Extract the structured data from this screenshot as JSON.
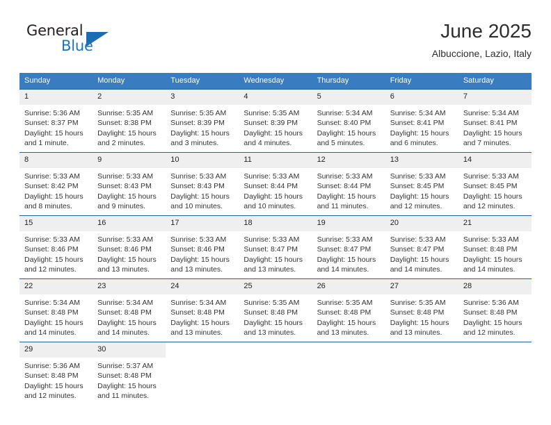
{
  "brand": {
    "name_top": "General",
    "name_bottom": "Blue",
    "flag_icon": "triangle-flag-icon",
    "color_blue": "#1b75bb",
    "color_dark": "#231f20"
  },
  "header": {
    "title": "June 2025",
    "location": "Albuccione, Lazio, Italy"
  },
  "theme": {
    "header_bg": "#3a7cc0",
    "daynum_bg": "#efefef",
    "row_divider": "#1f5fa0",
    "text": "#333333"
  },
  "weekday_headers": [
    "Sunday",
    "Monday",
    "Tuesday",
    "Wednesday",
    "Thursday",
    "Friday",
    "Saturday"
  ],
  "weeks": [
    {
      "days": [
        {
          "num": "1",
          "sunrise": "Sunrise: 5:36 AM",
          "sunset": "Sunset: 8:37 PM",
          "daylight_1": "Daylight: 15 hours",
          "daylight_2": "and 1 minute."
        },
        {
          "num": "2",
          "sunrise": "Sunrise: 5:35 AM",
          "sunset": "Sunset: 8:38 PM",
          "daylight_1": "Daylight: 15 hours",
          "daylight_2": "and 2 minutes."
        },
        {
          "num": "3",
          "sunrise": "Sunrise: 5:35 AM",
          "sunset": "Sunset: 8:39 PM",
          "daylight_1": "Daylight: 15 hours",
          "daylight_2": "and 3 minutes."
        },
        {
          "num": "4",
          "sunrise": "Sunrise: 5:35 AM",
          "sunset": "Sunset: 8:39 PM",
          "daylight_1": "Daylight: 15 hours",
          "daylight_2": "and 4 minutes."
        },
        {
          "num": "5",
          "sunrise": "Sunrise: 5:34 AM",
          "sunset": "Sunset: 8:40 PM",
          "daylight_1": "Daylight: 15 hours",
          "daylight_2": "and 5 minutes."
        },
        {
          "num": "6",
          "sunrise": "Sunrise: 5:34 AM",
          "sunset": "Sunset: 8:41 PM",
          "daylight_1": "Daylight: 15 hours",
          "daylight_2": "and 6 minutes."
        },
        {
          "num": "7",
          "sunrise": "Sunrise: 5:34 AM",
          "sunset": "Sunset: 8:41 PM",
          "daylight_1": "Daylight: 15 hours",
          "daylight_2": "and 7 minutes."
        }
      ]
    },
    {
      "days": [
        {
          "num": "8",
          "sunrise": "Sunrise: 5:33 AM",
          "sunset": "Sunset: 8:42 PM",
          "daylight_1": "Daylight: 15 hours",
          "daylight_2": "and 8 minutes."
        },
        {
          "num": "9",
          "sunrise": "Sunrise: 5:33 AM",
          "sunset": "Sunset: 8:43 PM",
          "daylight_1": "Daylight: 15 hours",
          "daylight_2": "and 9 minutes."
        },
        {
          "num": "10",
          "sunrise": "Sunrise: 5:33 AM",
          "sunset": "Sunset: 8:43 PM",
          "daylight_1": "Daylight: 15 hours",
          "daylight_2": "and 10 minutes."
        },
        {
          "num": "11",
          "sunrise": "Sunrise: 5:33 AM",
          "sunset": "Sunset: 8:44 PM",
          "daylight_1": "Daylight: 15 hours",
          "daylight_2": "and 10 minutes."
        },
        {
          "num": "12",
          "sunrise": "Sunrise: 5:33 AM",
          "sunset": "Sunset: 8:44 PM",
          "daylight_1": "Daylight: 15 hours",
          "daylight_2": "and 11 minutes."
        },
        {
          "num": "13",
          "sunrise": "Sunrise: 5:33 AM",
          "sunset": "Sunset: 8:45 PM",
          "daylight_1": "Daylight: 15 hours",
          "daylight_2": "and 12 minutes."
        },
        {
          "num": "14",
          "sunrise": "Sunrise: 5:33 AM",
          "sunset": "Sunset: 8:45 PM",
          "daylight_1": "Daylight: 15 hours",
          "daylight_2": "and 12 minutes."
        }
      ]
    },
    {
      "days": [
        {
          "num": "15",
          "sunrise": "Sunrise: 5:33 AM",
          "sunset": "Sunset: 8:46 PM",
          "daylight_1": "Daylight: 15 hours",
          "daylight_2": "and 12 minutes."
        },
        {
          "num": "16",
          "sunrise": "Sunrise: 5:33 AM",
          "sunset": "Sunset: 8:46 PM",
          "daylight_1": "Daylight: 15 hours",
          "daylight_2": "and 13 minutes."
        },
        {
          "num": "17",
          "sunrise": "Sunrise: 5:33 AM",
          "sunset": "Sunset: 8:46 PM",
          "daylight_1": "Daylight: 15 hours",
          "daylight_2": "and 13 minutes."
        },
        {
          "num": "18",
          "sunrise": "Sunrise: 5:33 AM",
          "sunset": "Sunset: 8:47 PM",
          "daylight_1": "Daylight: 15 hours",
          "daylight_2": "and 13 minutes."
        },
        {
          "num": "19",
          "sunrise": "Sunrise: 5:33 AM",
          "sunset": "Sunset: 8:47 PM",
          "daylight_1": "Daylight: 15 hours",
          "daylight_2": "and 14 minutes."
        },
        {
          "num": "20",
          "sunrise": "Sunrise: 5:33 AM",
          "sunset": "Sunset: 8:47 PM",
          "daylight_1": "Daylight: 15 hours",
          "daylight_2": "and 14 minutes."
        },
        {
          "num": "21",
          "sunrise": "Sunrise: 5:33 AM",
          "sunset": "Sunset: 8:48 PM",
          "daylight_1": "Daylight: 15 hours",
          "daylight_2": "and 14 minutes."
        }
      ]
    },
    {
      "days": [
        {
          "num": "22",
          "sunrise": "Sunrise: 5:34 AM",
          "sunset": "Sunset: 8:48 PM",
          "daylight_1": "Daylight: 15 hours",
          "daylight_2": "and 14 minutes."
        },
        {
          "num": "23",
          "sunrise": "Sunrise: 5:34 AM",
          "sunset": "Sunset: 8:48 PM",
          "daylight_1": "Daylight: 15 hours",
          "daylight_2": "and 14 minutes."
        },
        {
          "num": "24",
          "sunrise": "Sunrise: 5:34 AM",
          "sunset": "Sunset: 8:48 PM",
          "daylight_1": "Daylight: 15 hours",
          "daylight_2": "and 13 minutes."
        },
        {
          "num": "25",
          "sunrise": "Sunrise: 5:35 AM",
          "sunset": "Sunset: 8:48 PM",
          "daylight_1": "Daylight: 15 hours",
          "daylight_2": "and 13 minutes."
        },
        {
          "num": "26",
          "sunrise": "Sunrise: 5:35 AM",
          "sunset": "Sunset: 8:48 PM",
          "daylight_1": "Daylight: 15 hours",
          "daylight_2": "and 13 minutes."
        },
        {
          "num": "27",
          "sunrise": "Sunrise: 5:35 AM",
          "sunset": "Sunset: 8:48 PM",
          "daylight_1": "Daylight: 15 hours",
          "daylight_2": "and 13 minutes."
        },
        {
          "num": "28",
          "sunrise": "Sunrise: 5:36 AM",
          "sunset": "Sunset: 8:48 PM",
          "daylight_1": "Daylight: 15 hours",
          "daylight_2": "and 12 minutes."
        }
      ]
    },
    {
      "days": [
        {
          "num": "29",
          "sunrise": "Sunrise: 5:36 AM",
          "sunset": "Sunset: 8:48 PM",
          "daylight_1": "Daylight: 15 hours",
          "daylight_2": "and 12 minutes."
        },
        {
          "num": "30",
          "sunrise": "Sunrise: 5:37 AM",
          "sunset": "Sunset: 8:48 PM",
          "daylight_1": "Daylight: 15 hours",
          "daylight_2": "and 11 minutes."
        },
        {
          "num": "",
          "sunrise": "",
          "sunset": "",
          "daylight_1": "",
          "daylight_2": ""
        },
        {
          "num": "",
          "sunrise": "",
          "sunset": "",
          "daylight_1": "",
          "daylight_2": ""
        },
        {
          "num": "",
          "sunrise": "",
          "sunset": "",
          "daylight_1": "",
          "daylight_2": ""
        },
        {
          "num": "",
          "sunrise": "",
          "sunset": "",
          "daylight_1": "",
          "daylight_2": ""
        },
        {
          "num": "",
          "sunrise": "",
          "sunset": "",
          "daylight_1": "",
          "daylight_2": ""
        }
      ]
    }
  ]
}
